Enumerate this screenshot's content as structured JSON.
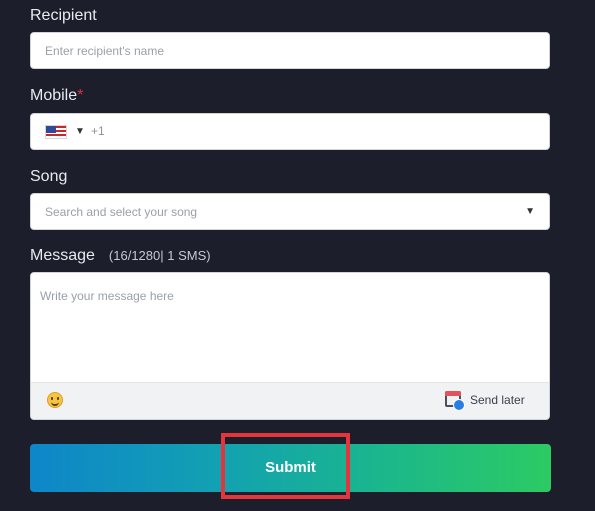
{
  "recipient": {
    "label": "Recipient",
    "placeholder": "Enter recipient's name"
  },
  "mobile": {
    "label": "Mobile",
    "required_marker": "*",
    "country_code": "+1",
    "country_flag_icon": "us-flag-icon"
  },
  "song": {
    "label": "Song",
    "placeholder": "Search and select your song"
  },
  "message": {
    "label": "Message",
    "counter": "(16/1280| 1 SMS)",
    "placeholder": "Write your message here",
    "send_later_label": "Send later"
  },
  "submit_label": "Submit",
  "colors": {
    "background": "#1c1f2b",
    "required": "#e0303e",
    "highlight": "#e5353c",
    "gradient_start": "#0e86c9",
    "gradient_end": "#2ccb63"
  }
}
